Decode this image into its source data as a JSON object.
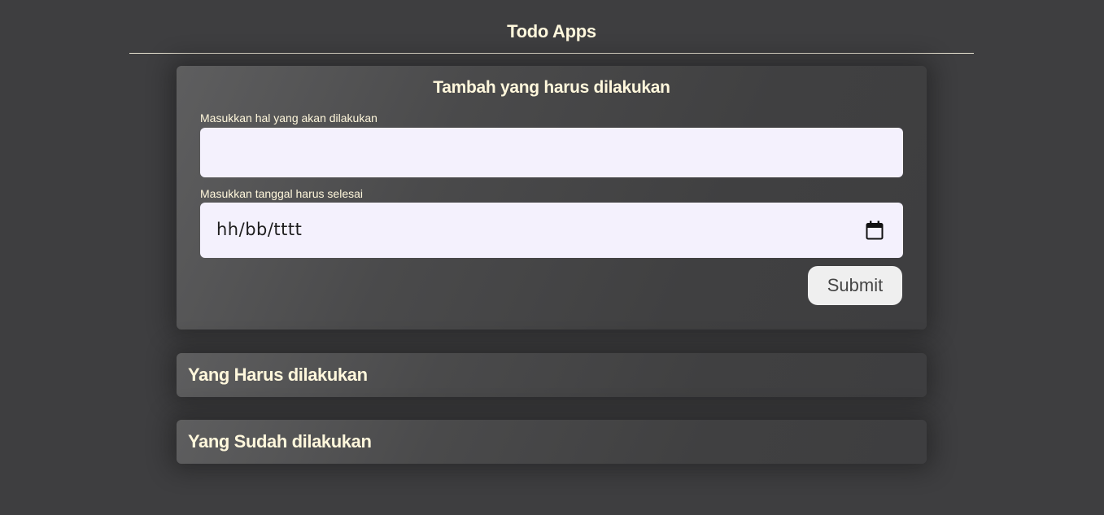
{
  "header": {
    "title": "Todo Apps"
  },
  "form": {
    "heading": "Tambah yang harus dilakukan",
    "title_label": "Masukkan hal yang akan dilakukan",
    "title_value": "",
    "date_label": "Masukkan tanggal harus selesai",
    "date_placeholder": "hh/bb/tttt",
    "submit_label": "Submit"
  },
  "sections": {
    "todo_heading": "Yang Harus dilakukan",
    "done_heading": "Yang Sudah dilakukan"
  },
  "icons": {
    "date_picker": "calendar-icon"
  },
  "colors": {
    "background": "#3e3e40",
    "text_accent": "#fff7dc",
    "input_background": "#f4f1fd",
    "button_background": "#efefef"
  }
}
